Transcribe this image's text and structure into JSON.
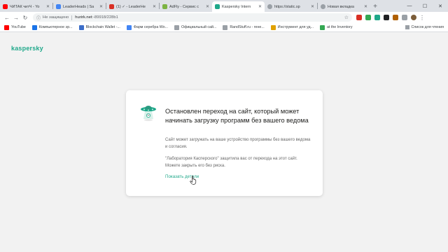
{
  "browser": {
    "tabs": [
      {
        "title": "ЧИТАК читЧ - Yo",
        "favicon_color": "#ff0000",
        "active": false
      },
      {
        "title": "LeaderHeads | Sa",
        "favicon_color": "#4285f4",
        "active": false
      },
      {
        "title": "(1) ✓ - LeaderHe",
        "favicon_color": "#d93025",
        "active": false
      },
      {
        "title": "AdFly - Сервис с",
        "favicon_color": "#7cb342",
        "active": false
      },
      {
        "title": "Kaspersky Intern",
        "favicon_color": "#1fa88a",
        "active": true
      },
      {
        "title": "https://static.sp",
        "favicon_color": "#5f6368",
        "active": false
      },
      {
        "title": "Новая вкладка",
        "favicon_color": "#5f6368",
        "active": false
      }
    ],
    "new_tab_label": "+",
    "window_controls": {
      "minimize": "—",
      "maximize": "☐",
      "close": "✕"
    },
    "address": {
      "security_label": "Не защищено",
      "host": "hurirk.net",
      "path": ":-89918/228b1"
    },
    "bookmarks": [
      {
        "label": "YouTube",
        "icon_color": "#ff0000"
      },
      {
        "label": "Компьютерное эр...",
        "icon_color": "#1a73e8"
      },
      {
        "label": "Blockchain Wallet -...",
        "icon_color": "#3c6ec9"
      },
      {
        "label": "Фарм серебра Wo...",
        "icon_color": "#4285f4"
      },
      {
        "label": "Официальный сай...",
        "icon_color": "#9aa0a6"
      },
      {
        "label": "RandStuff.ru - гене...",
        "icon_color": "#9aa0a6"
      },
      {
        "label": "Инструмент для уд...",
        "icon_color": "#e0a100"
      },
      {
        "label": "at the Inventory",
        "icon_color": "#34a853"
      }
    ],
    "reading_list_label": "Список для чтения"
  },
  "page": {
    "logo": "kaspersky",
    "card": {
      "title": "Остановлен переход на сайт, который может начинать загрузку программ без вашего ведома",
      "text1": "Сайт может загружать на ваше устройство программы без вашего ведома и согласия.",
      "text2": "\"Лаборатория Касперского\" защитила вас от перехода на этот сайт. Можете закрыть его без риска.",
      "details_link": "Показать детали"
    }
  },
  "colors": {
    "brand": "#1fa88a",
    "page_bg": "#f2f2f2",
    "card_bg": "#ffffff"
  }
}
